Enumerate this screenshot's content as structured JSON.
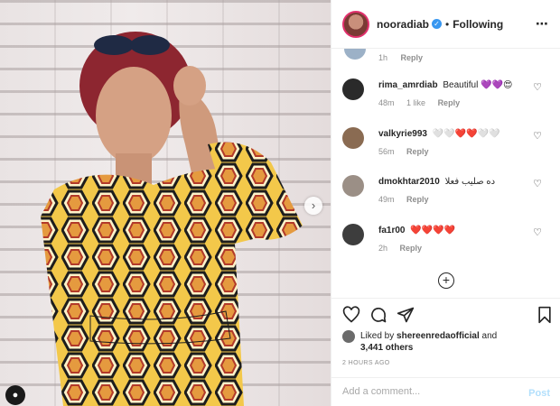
{
  "post": {
    "username": "nooradiab",
    "follow_status": "Following",
    "more_icon": "⋯"
  },
  "partial_comment": {
    "age": "1h",
    "reply_label": "Reply"
  },
  "comments": [
    {
      "username": "rima_amrdiab",
      "text": "Beautiful 💜💜😍",
      "age": "48m",
      "likes": "1 like",
      "reply_label": "Reply",
      "avatar_color": "#2a2a2a"
    },
    {
      "username": "valkyrie993",
      "text": "🤍🤍❤️❤️🤍🤍",
      "age": "56m",
      "likes": "",
      "reply_label": "Reply",
      "avatar_color": "#8a6b52"
    },
    {
      "username": "dmokhtar2010",
      "text": "ده صليب فعلا",
      "age": "49m",
      "likes": "",
      "reply_label": "Reply",
      "avatar_color": "#9b8f86"
    },
    {
      "username": "fa1r00",
      "text": "❤️❤️❤️❤️",
      "age": "2h",
      "likes": "",
      "reply_label": "Reply",
      "avatar_color": "#3d3d3d"
    }
  ],
  "likes_line": {
    "prefix": "Liked by",
    "user": "shereenredaofficial",
    "joiner": "and",
    "count": "3,441 others"
  },
  "timestamp": "2 HOURS AGO",
  "composer": {
    "placeholder": "Add a comment...",
    "post_label": "Post"
  },
  "colors": {
    "link_blue": "#3897f0",
    "post_disabled": "#b2dffc",
    "heart_red": "#ed4956"
  }
}
